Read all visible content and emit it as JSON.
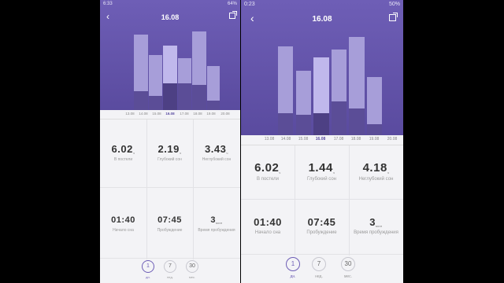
{
  "left": {
    "status": {
      "time": "6:33",
      "right": "64%"
    },
    "title": "16.08",
    "ticks": [
      "13.08",
      "14.08",
      "15.08",
      "16.08",
      "17.08",
      "18.08",
      "19.08",
      "20.08"
    ],
    "selected_tick": 3,
    "stats": [
      {
        "value": "6.02",
        "unit": "ч",
        "label": "В постели"
      },
      {
        "value": "2.19",
        "unit": "ч",
        "label": "Глубокий сон"
      },
      {
        "value": "3.43",
        "unit": "ч",
        "label": "Неглубокий сон"
      },
      {
        "value": "01:40",
        "unit": "",
        "label": "Начало сна"
      },
      {
        "value": "07:45",
        "unit": "",
        "label": "Пробуждение"
      },
      {
        "value": "3",
        "unit": "мин",
        "label": "Время пробуждения"
      }
    ],
    "periods": [
      {
        "value": "1",
        "label": "дн."
      },
      {
        "value": "7",
        "label": "нед."
      },
      {
        "value": "30",
        "label": "мес."
      }
    ]
  },
  "right": {
    "status": {
      "time": "0:23",
      "right": "50%"
    },
    "title": "16.08",
    "ticks": [
      "13.08",
      "14.08",
      "15.08",
      "16.08",
      "17.08",
      "18.08",
      "19.08",
      "20.08"
    ],
    "selected_tick": 3,
    "stats": [
      {
        "value": "6.02",
        "unit": "ч",
        "label": "В постели"
      },
      {
        "value": "1.44",
        "unit": "ч",
        "label": "Глубокий сон"
      },
      {
        "value": "4.18",
        "unit": "ч",
        "label": "Неглубокий сон"
      },
      {
        "value": "01:40",
        "unit": "",
        "label": "Начало сна"
      },
      {
        "value": "07:45",
        "unit": "",
        "label": "Пробуждение"
      },
      {
        "value": "3",
        "unit": "мин",
        "label": "Время пробуждения"
      }
    ],
    "periods": [
      {
        "value": "1",
        "label": "дн."
      },
      {
        "value": "7",
        "label": "нед."
      },
      {
        "value": "30",
        "label": "мес."
      }
    ]
  },
  "colors": {
    "accent": "#6e5eb6",
    "light_sleep": "#a79ed9",
    "deep_sleep": "#5b4d97"
  }
}
